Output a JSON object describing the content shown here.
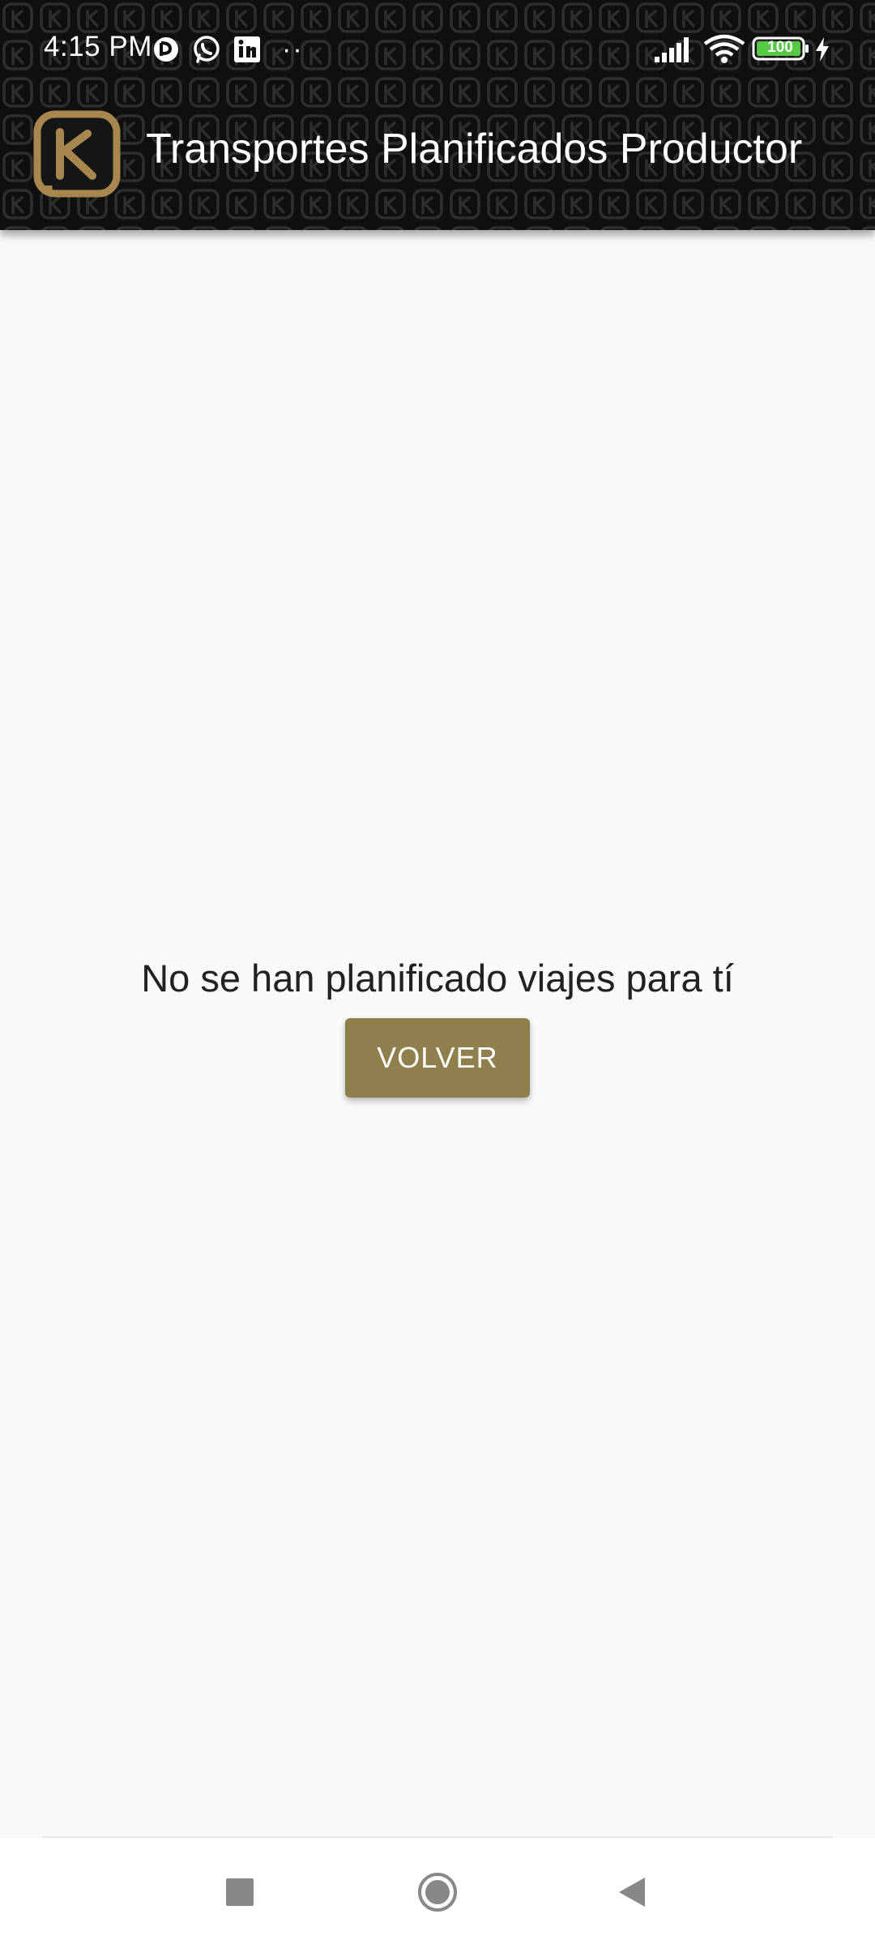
{
  "status_bar": {
    "time": "4:15 PM",
    "notification_icons": [
      "app-notification-icon",
      "whatsapp-icon",
      "linkedin-icon"
    ],
    "more_notifications": "··",
    "battery_level": "100",
    "signal_icon": "signal-icon",
    "wifi_icon": "wifi-icon",
    "charging_icon": "charging-icon"
  },
  "toolbar": {
    "logo_icon": "brand-logo-icon",
    "title": "Transportes Planificados Productor"
  },
  "main": {
    "empty_message": "No se han planificado viajes para tí",
    "back_button_label": "VOLVER"
  },
  "nav_bar": {
    "recents_icon": "recents-square-icon",
    "home_icon": "home-circle-icon",
    "back_icon": "back-triangle-icon"
  },
  "colors": {
    "header_background": "#0f0f0f",
    "brand_gold": "#a8874f",
    "button_background": "#8f7f4d",
    "page_background": "#f9f9f9",
    "battery_fill": "#57c843"
  }
}
